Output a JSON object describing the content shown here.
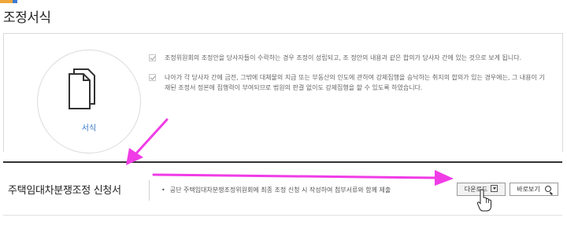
{
  "page": {
    "title": "조정서식"
  },
  "info": {
    "icon_label": "서식",
    "bullets": [
      "조정위원회의 조정안을 당사자들이 수락하는 경우 조정이 성립되고, 조 정안의 내용과 같은 합의가 당사자 간에 있는 것으로 보게 됩니다.",
      "나아가 각 당사자 간에 금전, 그밖에 대체물의 지급 또는 부동산의 인도에 관하여 강제집행을 승낙하는 취지의 합의가 있는 경우에는, 그 내용이 기재된 조정서 정본에 집행력이 부여되므로 법원의 판결 없이도 강제집행을 할 수 있도록 하였습니다."
    ]
  },
  "form_row": {
    "title": "주택임대차분쟁조정 신청서",
    "description": "공단 주택임대차분쟁조정위원회에 최종 조정 신청 시 작성하여 첨부서류와 함께 제출",
    "download_label": "다운로드",
    "view_label": "바로보기"
  },
  "colors": {
    "annotation_arrow": "#f03ce6",
    "link_blue": "#3a7ac6"
  },
  "icons": [
    "document-icon",
    "check-icon",
    "download-icon",
    "search-icon",
    "hand-cursor-icon"
  ]
}
